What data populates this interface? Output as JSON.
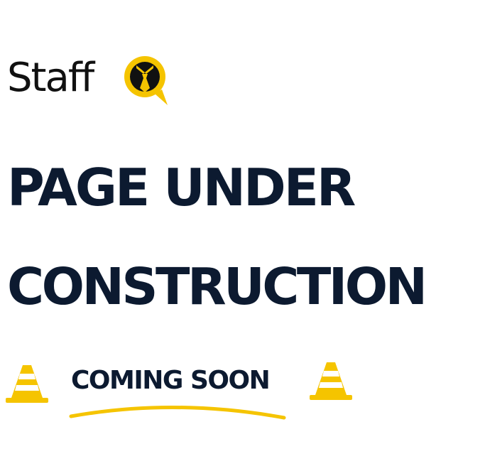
{
  "logo": {
    "wordmark": "Staff",
    "icon": "tie-speech-bubble-icon",
    "accent_color": "#f5c400"
  },
  "headline": {
    "line1": "PAGE UNDER",
    "line2": "CONSTRUCTION"
  },
  "status": {
    "label": "COMING SOON",
    "left_icon": "traffic-cone-icon",
    "right_icon": "traffic-cone-icon"
  },
  "colors": {
    "text": "#0c1a30",
    "accent": "#f5c400",
    "background": "#ffffff"
  }
}
